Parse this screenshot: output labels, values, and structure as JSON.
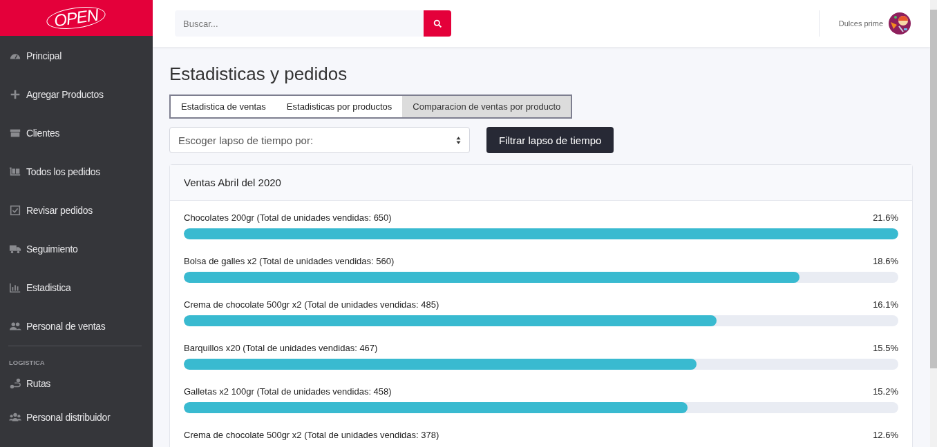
{
  "logo": {
    "text": "OPEN"
  },
  "sidebar": {
    "items": [
      {
        "label": "Principal"
      },
      {
        "label": "Agregar Productos"
      },
      {
        "label": "Clientes"
      },
      {
        "label": "Todos los pedidos"
      },
      {
        "label": "Revisar pedidos"
      },
      {
        "label": "Seguimiento"
      },
      {
        "label": "Estadistica"
      },
      {
        "label": "Personal de ventas"
      }
    ],
    "section": "LOGISTICA",
    "section_items": [
      {
        "label": "Rutas"
      },
      {
        "label": "Personal distribuidor"
      }
    ]
  },
  "header": {
    "search": {
      "placeholder": "Buscar..."
    },
    "user": "Dulces prime"
  },
  "page_title": "Estadisticas y pedidos",
  "tabs": [
    {
      "label": "Estadistica de ventas",
      "selected": false
    },
    {
      "label": "Estadisticas por productos",
      "selected": false
    },
    {
      "label": "Comparacion de ventas por producto",
      "selected": true
    }
  ],
  "filter": {
    "select": "Escoger lapso de tiempo por:",
    "button": "Filtrar lapso de tiempo"
  },
  "card": {
    "title": "Ventas Abril del 2020",
    "rows": [
      {
        "label": "Chocolates 200gr (Total de unidades vendidas: 650)",
        "percent": "21.6%",
        "level": 1
      },
      {
        "label": "Bolsa de galles x2 (Total de unidades vendidas: 560)",
        "percent": "18.6%",
        "level": 0.862
      },
      {
        "label": "Crema de chocolate 500gr x2 (Total de unidades vendidas: 485)",
        "percent": "16.1%",
        "level": 0.746
      },
      {
        "label": "Barquillos x20 (Total de unidades vendidas: 467)",
        "percent": "15.5%",
        "level": 0.718
      },
      {
        "label": "Galletas x2 100gr (Total de unidades vendidas: 458)",
        "percent": "15.2%",
        "level": 0.705
      },
      {
        "label": "Crema de chocolate 500gr x2 (Total de unidades vendidas: 378)",
        "percent": "12.6%"
      }
    ]
  }
}
